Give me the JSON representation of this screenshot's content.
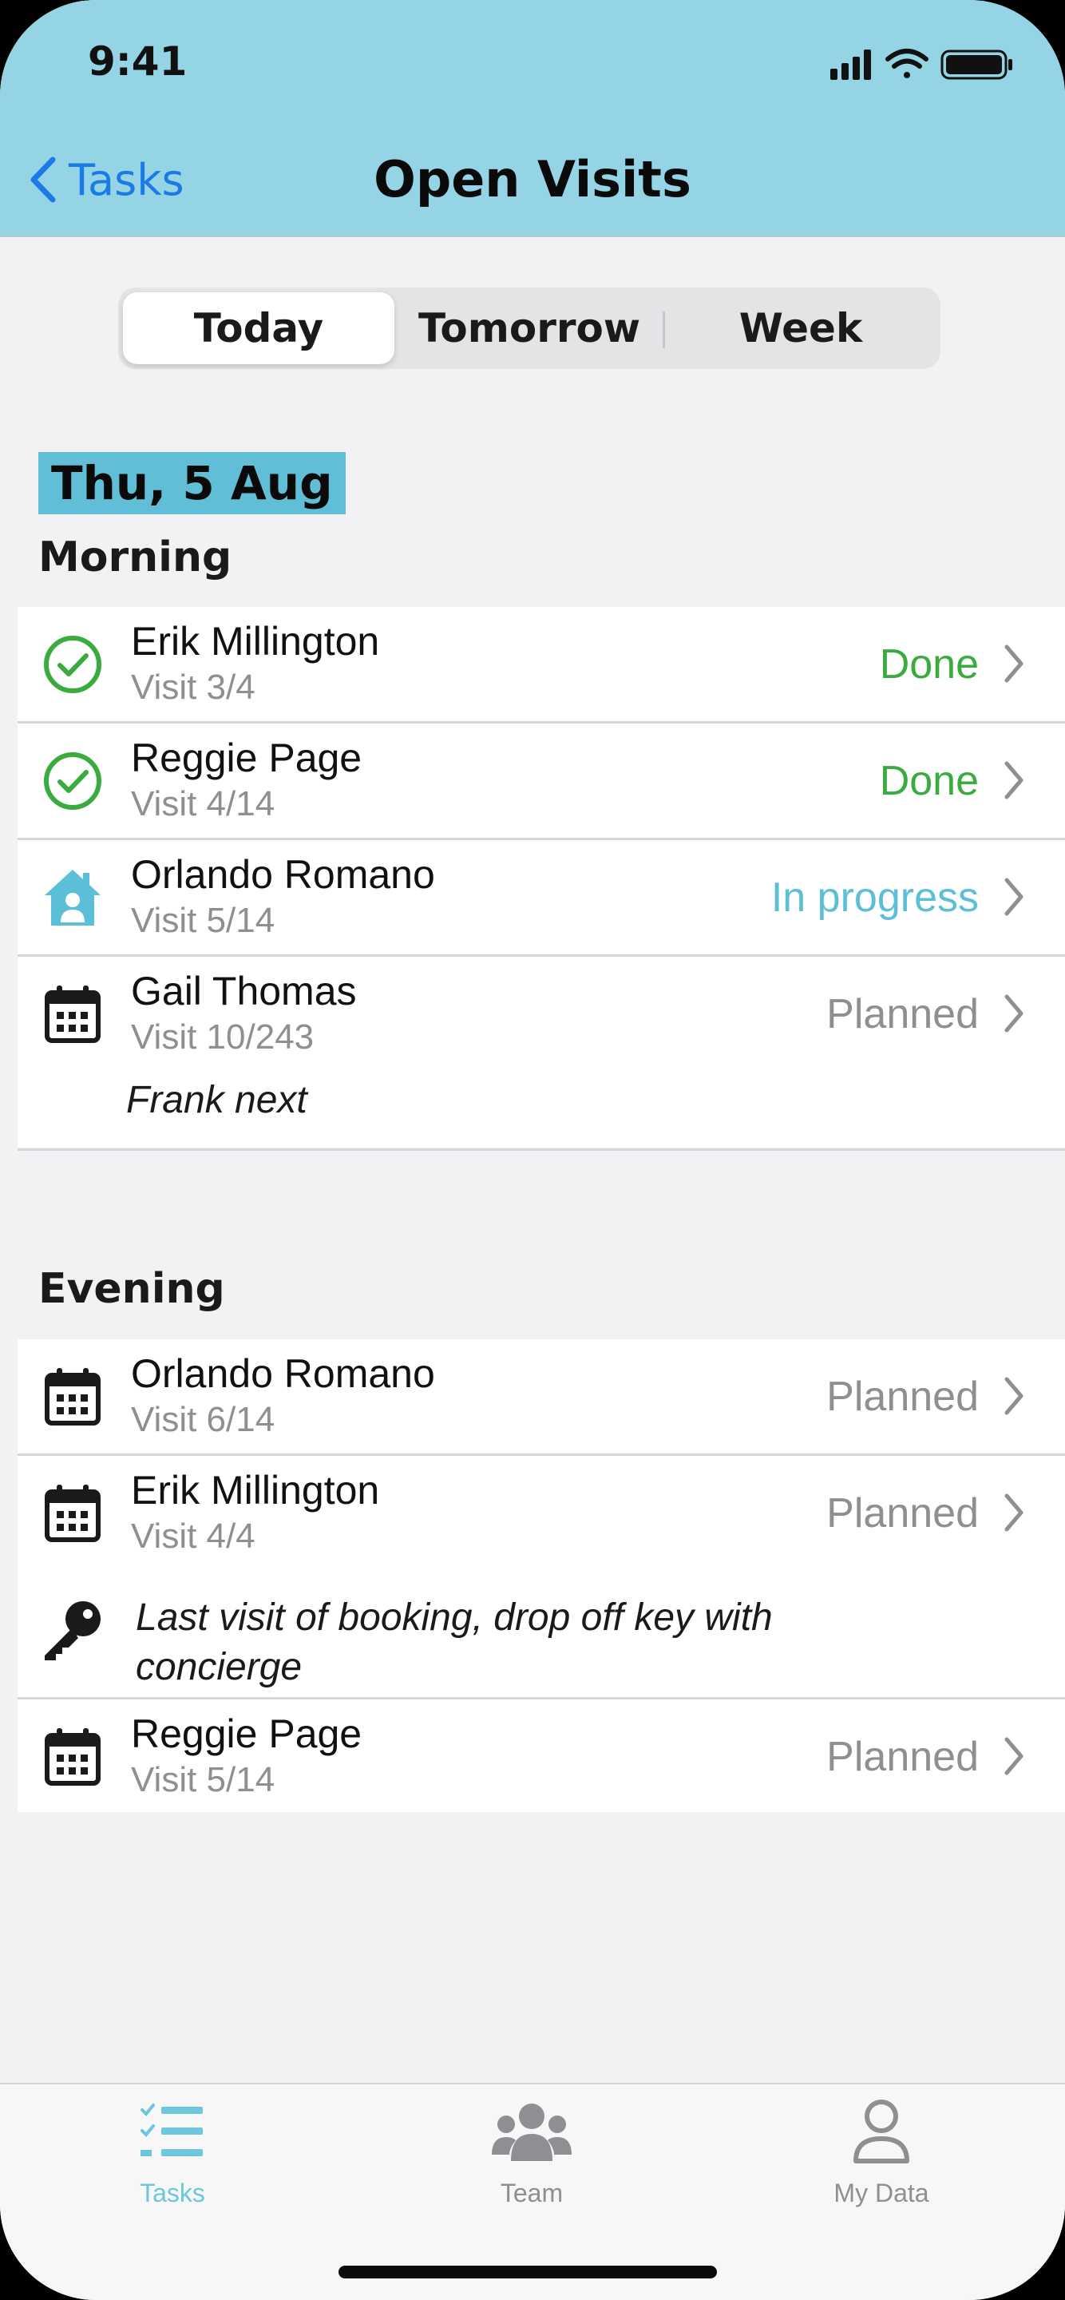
{
  "status_bar": {
    "time": "9:41"
  },
  "nav": {
    "back_label": "Tasks",
    "title": "Open Visits"
  },
  "segments": {
    "items": [
      "Today",
      "Tomorrow",
      "Week"
    ],
    "selected": "Today"
  },
  "date_header": "Thu, 5 Aug",
  "sections": [
    {
      "label": "Morning",
      "rows": [
        {
          "name": "Erik Millington",
          "visit": "Visit 3/4",
          "status": "Done",
          "icon": "check-circle-icon"
        },
        {
          "name": "Reggie Page",
          "visit": "Visit 4/14",
          "status": "Done",
          "icon": "check-circle-icon"
        },
        {
          "name": "Orlando Romano",
          "visit": "Visit 5/14",
          "status": "In progress",
          "icon": "house-person-icon"
        },
        {
          "name": "Gail Thomas",
          "visit": "Visit 10/243",
          "status": "Planned",
          "icon": "calendar-icon",
          "note": "Frank next"
        }
      ]
    },
    {
      "label": "Evening",
      "rows": [
        {
          "name": "Orlando Romano",
          "visit": "Visit 6/14",
          "status": "Planned",
          "icon": "calendar-icon"
        },
        {
          "name": "Erik Millington",
          "visit": "Visit 4/4",
          "status": "Planned",
          "icon": "calendar-icon",
          "note": "Last visit of booking, drop off key with concierge",
          "note_icon": "key-icon"
        },
        {
          "name": "Reggie Page",
          "visit": "Visit 5/14",
          "status": "Planned",
          "icon": "calendar-icon"
        }
      ]
    }
  ],
  "tabbar": {
    "items": [
      {
        "label": "Tasks",
        "icon": "tasks-list-icon",
        "active": true
      },
      {
        "label": "Team",
        "icon": "team-icon",
        "active": false
      },
      {
        "label": "My Data",
        "icon": "person-icon",
        "active": false
      }
    ]
  },
  "colors": {
    "header_bg": "#94d4e4",
    "date_highlight": "#60bfd6",
    "done": "#3aab3e",
    "in_progress": "#5bbfd8",
    "planned": "#8e8e93",
    "link_blue": "#1b7ae6",
    "tab_active": "#6cc7dc"
  }
}
